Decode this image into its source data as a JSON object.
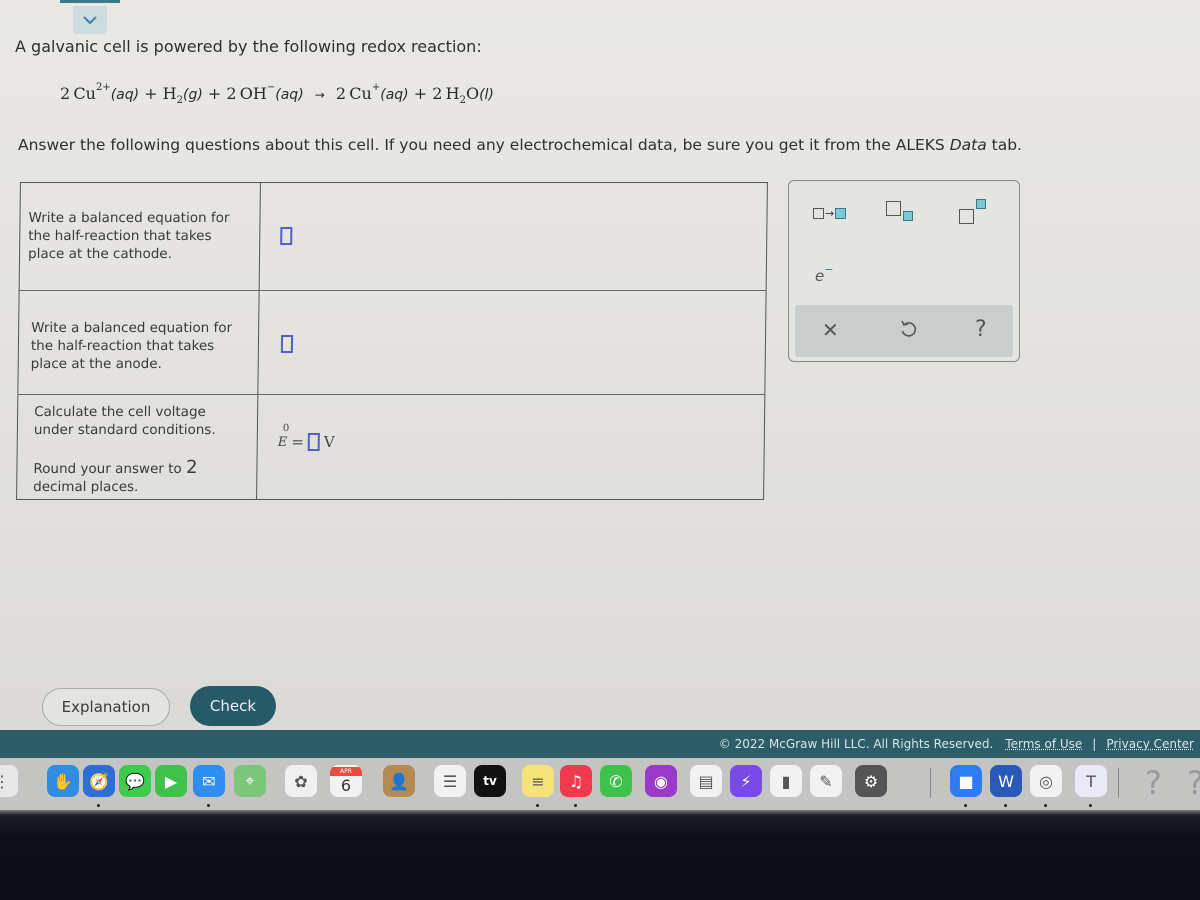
{
  "question": {
    "intro": "A galvanic cell is powered by the following redox reaction:",
    "equation": {
      "reactants": [
        {
          "coef": "2",
          "species": "Cu",
          "charge": "2+",
          "state": "(aq)"
        },
        {
          "coef": "",
          "species": "H",
          "sub": "2",
          "state": "(g)"
        },
        {
          "coef": "2",
          "species": "OH",
          "charge": "−",
          "state": "(aq)"
        }
      ],
      "products": [
        {
          "coef": "2",
          "species": "Cu",
          "charge": "+",
          "state": "(aq)"
        },
        {
          "coef": "2",
          "species": "H",
          "sub": "2",
          "species2": "O",
          "state": "(l)"
        }
      ],
      "plus": "+",
      "arrow": "→"
    },
    "instructions_pre": "Answer the following questions about this cell. If you need any electrochemical data, be sure you get it from the ALEKS ",
    "instructions_em": "Data",
    "instructions_post": " tab."
  },
  "table": {
    "rows": [
      {
        "prompt": "Write a balanced equation for the half-reaction that takes place at the cathode.",
        "answer": ""
      },
      {
        "prompt": "Write a balanced equation for the half-reaction that takes place at the anode.",
        "answer": ""
      },
      {
        "prompt": "Calculate the cell voltage under standard conditions.",
        "round_pre": "Round your answer to ",
        "round_num": "2",
        "round_post": "decimal places.",
        "symbol": "E",
        "symbol_sup": "0",
        "equals": "=",
        "unit": "V",
        "answer": ""
      }
    ]
  },
  "palette": {
    "buttons": [
      {
        "name": "reaction-arrow",
        "icon": "box-arrow-box-icon",
        "glyph": "→"
      },
      {
        "name": "subscript",
        "icon": "subscript-icon"
      },
      {
        "name": "superscript",
        "icon": "superscript-icon"
      },
      {
        "name": "electron",
        "icon": "electron-icon",
        "label": "e",
        "sup": "−"
      }
    ],
    "actions": [
      {
        "name": "clear",
        "icon": "close-icon",
        "glyph": "✕"
      },
      {
        "name": "undo",
        "icon": "undo-icon"
      },
      {
        "name": "help",
        "icon": "help-icon",
        "glyph": "?"
      }
    ]
  },
  "buttons": {
    "explanation": "Explanation",
    "check": "Check"
  },
  "footer": {
    "copyright": "© 2022 McGraw Hill LLC. All Rights Reserved.",
    "terms": "Terms of Use",
    "separator": "|",
    "privacy": "Privacy Center"
  },
  "dock": {
    "apps": [
      {
        "name": "reminders",
        "icon": "reminders-icon",
        "color": "#e8e8e8",
        "glyph": "⋮"
      },
      {
        "name": "cleaner",
        "icon": "hand-icon",
        "color": "#2f8ee0",
        "glyph": "✋"
      },
      {
        "name": "safari",
        "icon": "compass-icon",
        "color": "#2d6fd6",
        "glyph": "🧭"
      },
      {
        "name": "messages",
        "icon": "chat-bubble-icon",
        "color": "#3ecb4b",
        "glyph": "💬"
      },
      {
        "name": "facetime",
        "icon": "video-camera-icon",
        "color": "#3ec24b",
        "glyph": "▶"
      },
      {
        "name": "mail",
        "icon": "envelope-icon",
        "color": "#2f8ef0",
        "glyph": "✉"
      },
      {
        "name": "maps",
        "icon": "map-icon",
        "color": "#7cc67a",
        "glyph": "⌖"
      },
      {
        "name": "photos",
        "icon": "flower-icon",
        "color": "#f0f0f0",
        "glyph": "✿"
      },
      {
        "name": "calendar",
        "icon": "calendar-icon",
        "month": "APR",
        "day": "6"
      },
      {
        "name": "contacts",
        "icon": "contacts-icon",
        "color": "#b38b52",
        "glyph": "👤"
      },
      {
        "name": "reminders-list",
        "icon": "list-icon",
        "color": "#f2f2f2",
        "glyph": "☰"
      },
      {
        "name": "apple-tv",
        "icon": "tv-icon",
        "color": "#111",
        "label": "tv"
      },
      {
        "name": "notes",
        "icon": "notes-icon",
        "color": "#f6e27a",
        "glyph": "≡"
      },
      {
        "name": "music",
        "icon": "music-note-icon",
        "color": "#f03a4e",
        "glyph": "♫"
      },
      {
        "name": "whatsapp",
        "icon": "phone-bubble-icon",
        "color": "#3ec24b",
        "glyph": "✆"
      },
      {
        "name": "podcasts",
        "icon": "podcast-icon",
        "color": "#9a3ac8",
        "glyph": "◉"
      },
      {
        "name": "keynote",
        "icon": "podium-icon",
        "color": "#f2f2f2",
        "glyph": "▤"
      },
      {
        "name": "messenger",
        "icon": "lightning-bubble-icon",
        "color": "#7a4ae8",
        "glyph": "⚡"
      },
      {
        "name": "numbers",
        "icon": "bar-chart-icon",
        "color": "#f2f2f2",
        "glyph": "▮"
      },
      {
        "name": "pages",
        "icon": "pen-icon",
        "color": "#f2f2f2",
        "glyph": "✎"
      },
      {
        "name": "system-preferences",
        "icon": "gear-icon",
        "color": "#555",
        "glyph": "⚙"
      },
      {
        "name": "zoom",
        "icon": "video-camera-icon",
        "color": "#2d7cf0",
        "glyph": "■"
      },
      {
        "name": "word",
        "icon": "word-icon",
        "color": "#2a5ab8",
        "glyph": "W"
      },
      {
        "name": "chrome",
        "icon": "chrome-icon",
        "color": "#f2f2f2",
        "glyph": "◎"
      },
      {
        "name": "teams",
        "icon": "teams-icon",
        "color": "#eaeaf6",
        "glyph": "T"
      }
    ],
    "trailing": [
      "?",
      "?"
    ]
  }
}
